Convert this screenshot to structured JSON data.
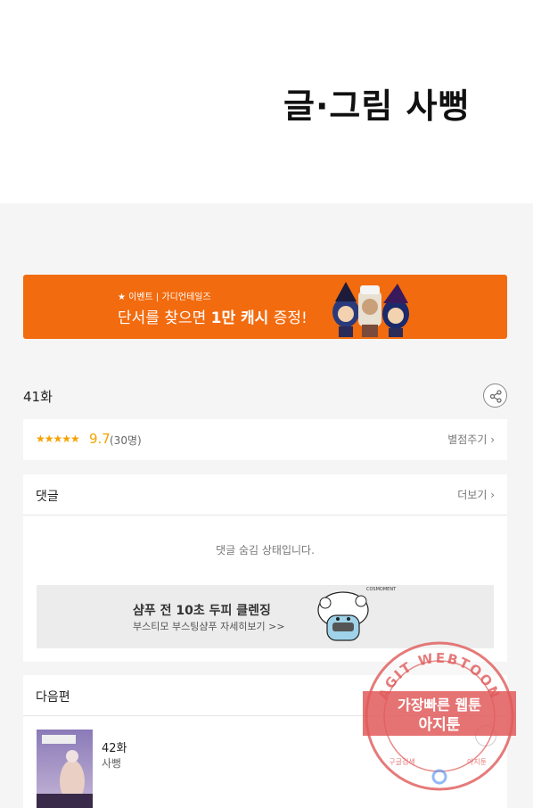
{
  "header": {
    "credit": "글·그림 사뻥"
  },
  "banner": {
    "tag": "★ 이벤트 | 가디언테일즈",
    "headline_prefix": "단서를 찾으면 ",
    "headline_bold": "1만 캐시",
    "headline_suffix": " 증정!"
  },
  "episode": {
    "title": "41화"
  },
  "rating": {
    "stars": "★★★★★",
    "score": "9.7",
    "votes": "(30명)",
    "rate_link": "별점주기 ›"
  },
  "comments": {
    "title": "댓글",
    "more": "더보기 ›",
    "hidden_message": "댓글 숨김 상태입니다."
  },
  "ad": {
    "title": "샴푸 전 10초 두피 클렌징",
    "subtitle": "부스티모 부스팅샴푸 자세히보기 >>",
    "brand_mark": "COSMOMENT"
  },
  "next": {
    "title": "다음편",
    "episode": "42화",
    "author": "사뻥"
  },
  "watermark": {
    "arc_text": "AGIT WEBTOON",
    "line1": "가장빠른 웹툰",
    "line2": "아지툰",
    "bottom_left": "구글검색",
    "bottom_right": "아지툰"
  },
  "colors": {
    "banner": "#f26b0f",
    "star": "#f5a200",
    "watermark": "#e05a5a"
  }
}
